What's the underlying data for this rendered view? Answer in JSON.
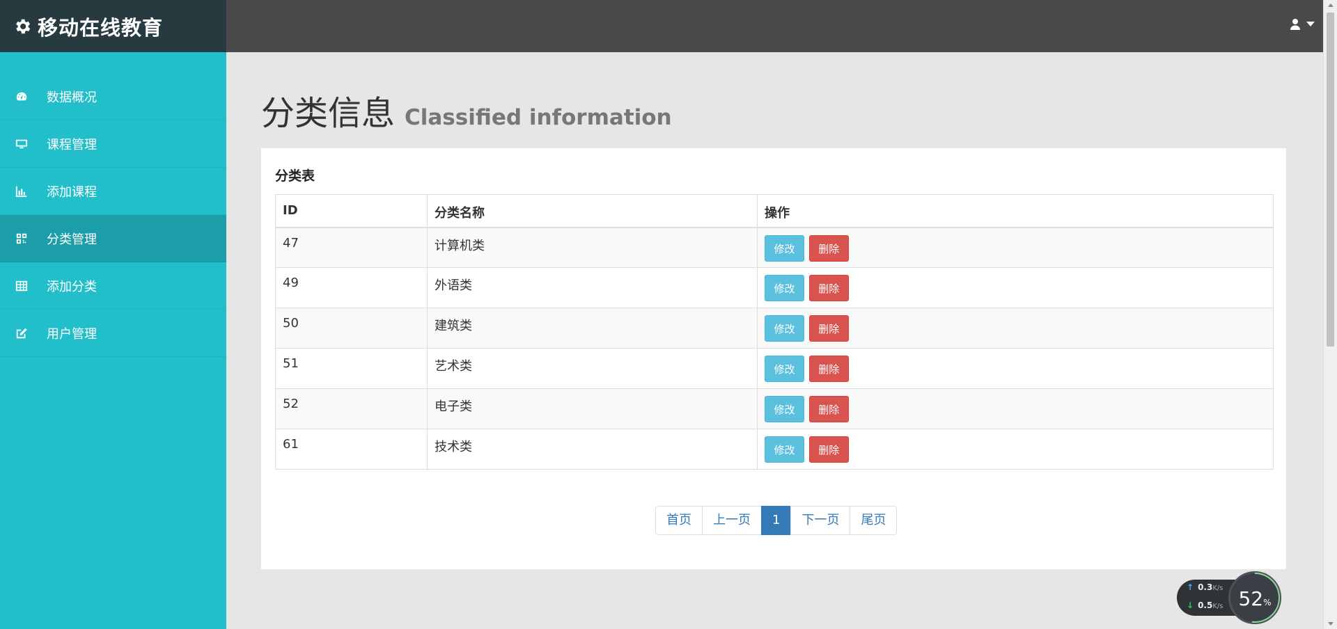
{
  "brand": {
    "title": "移动在线教育"
  },
  "sidebar": {
    "items": [
      {
        "label": "数据概况",
        "icon": "dashboard-icon",
        "active": false
      },
      {
        "label": "课程管理",
        "icon": "desktop-icon",
        "active": false
      },
      {
        "label": "添加课程",
        "icon": "bar-chart-icon",
        "active": false
      },
      {
        "label": "分类管理",
        "icon": "qrcode-icon",
        "active": true
      },
      {
        "label": "添加分类",
        "icon": "table-icon",
        "active": false
      },
      {
        "label": "用户管理",
        "icon": "edit-icon",
        "active": false
      }
    ]
  },
  "header": {
    "user_icon": "user-icon",
    "dropdown_icon": "caret-down-icon"
  },
  "page": {
    "title": "分类信息",
    "subtitle": "Classified information"
  },
  "panel": {
    "heading": "分类表",
    "columns": [
      "ID",
      "分类名称",
      "操作"
    ],
    "rows": [
      {
        "id": "47",
        "name": "计算机类"
      },
      {
        "id": "49",
        "name": "外语类"
      },
      {
        "id": "50",
        "name": "建筑类"
      },
      {
        "id": "51",
        "name": "艺术类"
      },
      {
        "id": "52",
        "name": "电子类"
      },
      {
        "id": "61",
        "name": "技术类"
      }
    ],
    "edit_label": "修改",
    "delete_label": "删除"
  },
  "pagination": {
    "first": "首页",
    "prev": "上一页",
    "current": "1",
    "next": "下一页",
    "last": "尾页"
  },
  "network_widget": {
    "upload": "0.3",
    "download": "0.5",
    "unit": "K/s",
    "percent": "52",
    "percent_sign": "%"
  },
  "colors": {
    "sidebar": "#22bfcb",
    "sidebar_active": "#1b9ea7",
    "brand_bg": "#263a3f",
    "topbar": "#4a4a4a",
    "edit_btn": "#5bc0de",
    "delete_btn": "#d9534f",
    "link": "#337ab7"
  }
}
